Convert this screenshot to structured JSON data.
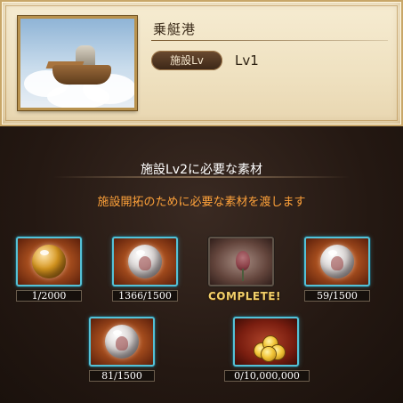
{
  "facility": {
    "name": "乗艇港",
    "level_label": "施設Lv",
    "level_value": "Lv1"
  },
  "requirements": {
    "title": "施設Lv2に必要な素材",
    "subtitle": "施設開拓のために必要な素材を渡します",
    "materials": [
      {
        "icon": "amber-orb-icon",
        "count": "1/2000"
      },
      {
        "icon": "character-orb-icon",
        "count": "1366/1500"
      },
      {
        "icon": "rose-icon",
        "count": "COMPLETE!"
      },
      {
        "icon": "character-orb-icon",
        "count": "59/1500"
      },
      {
        "icon": "character-orb-icon",
        "count": "81/1500"
      },
      {
        "icon": "gold-coins-icon",
        "count": "0/10,000,000"
      }
    ]
  },
  "colors": {
    "tile_border": "#55c1d6",
    "subtitle": "#ffa23a",
    "complete_text": "#f2cf6a"
  }
}
